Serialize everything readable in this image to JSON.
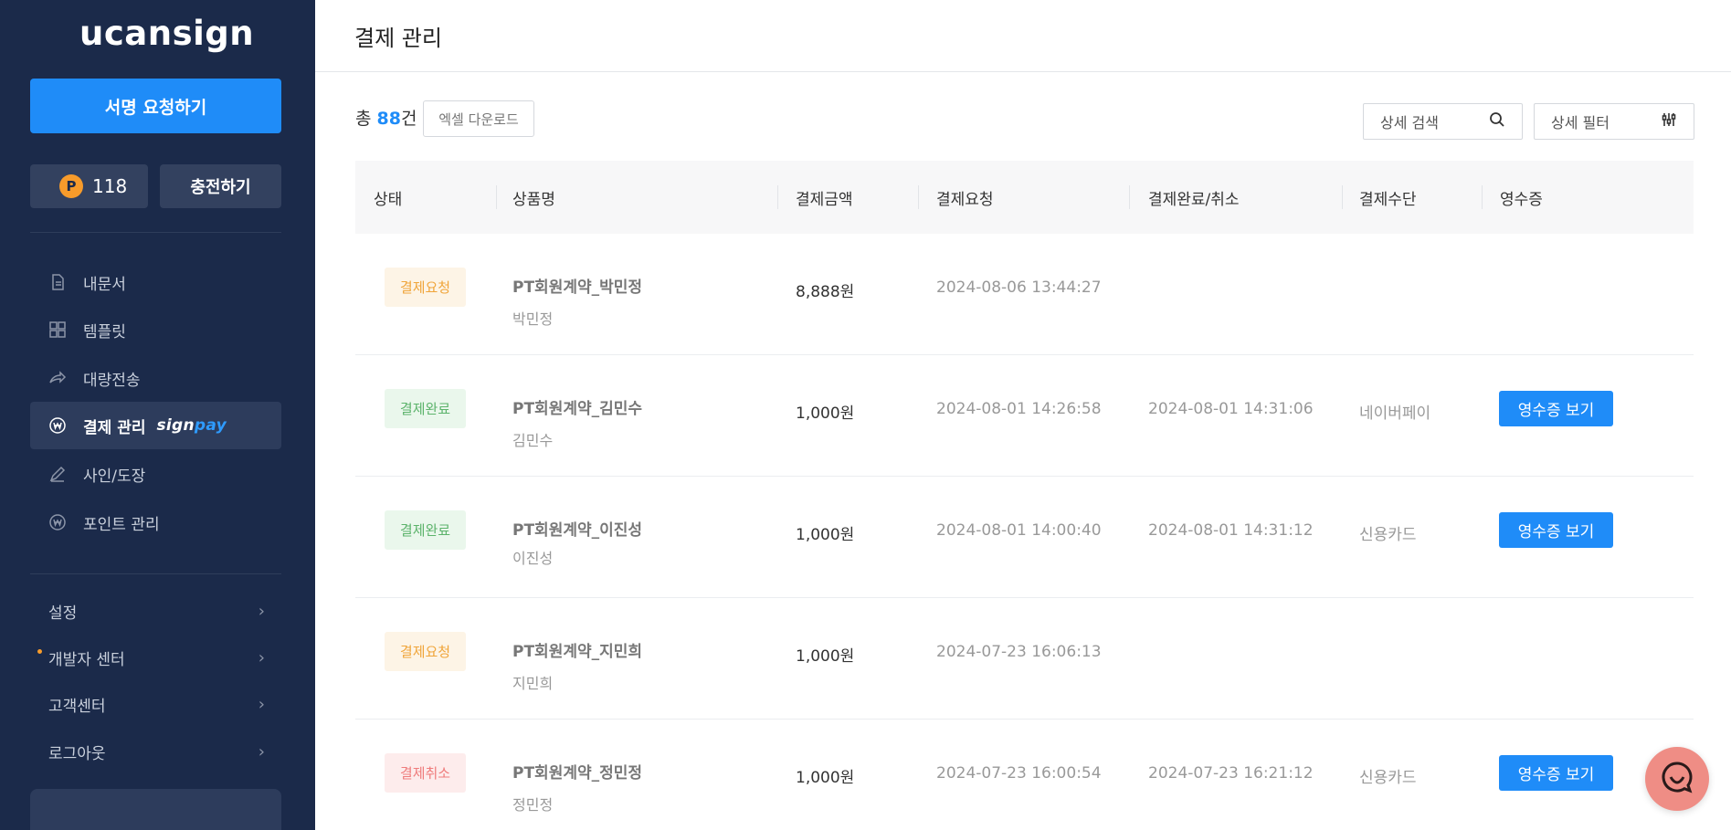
{
  "brand": {
    "logo_text": "ucansign"
  },
  "sidebar": {
    "request_button": "서명 요청하기",
    "points_value": "118",
    "points_icon": "P",
    "charge_button": "충전하기",
    "nav": [
      {
        "label": "내문서",
        "icon": "document-icon"
      },
      {
        "label": "템플릿",
        "icon": "template-icon"
      },
      {
        "label": "대량전송",
        "icon": "share-icon"
      },
      {
        "label": "결제 관리",
        "icon": "won-circle-icon",
        "badge_sign": "sign",
        "badge_pay": "pay"
      },
      {
        "label": "사인/도장",
        "icon": "pen-icon"
      },
      {
        "label": "포인트 관리",
        "icon": "won-circle-icon"
      }
    ],
    "sub": [
      {
        "label": "설정"
      },
      {
        "label": "개발자 센터"
      },
      {
        "label": "고객센터"
      },
      {
        "label": "로그아웃"
      }
    ]
  },
  "header": {
    "title": "결제 관리"
  },
  "toolbar": {
    "count_prefix": "총 ",
    "count": "88",
    "count_suffix": "건",
    "excel_button": "엑셀 다운로드",
    "search_label": "상세 검색",
    "filter_label": "상세 필터"
  },
  "table": {
    "columns": [
      "상태",
      "상품명",
      "결제금액",
      "결제요청",
      "결제완료/취소",
      "결제수단",
      "영수증"
    ],
    "rows": [
      {
        "status": "결제요청",
        "status_type": "req",
        "product": "PT회원계약_박민정",
        "customer": "박민정",
        "amount": "8,888원",
        "requested": "2024-08-06 13:44:27",
        "completed": "",
        "method": "",
        "receipt": ""
      },
      {
        "status": "결제완료",
        "status_type": "done",
        "product": "PT회원계약_김민수",
        "customer": "김민수",
        "amount": "1,000원",
        "requested": "2024-08-01 14:26:58",
        "completed": "2024-08-01 14:31:06",
        "method": "네이버페이",
        "receipt": "영수증 보기"
      },
      {
        "status": "결제완료",
        "status_type": "done",
        "product": "PT회원계약_이진성",
        "customer": "이진성",
        "amount": "1,000원",
        "requested": "2024-08-01 14:00:40",
        "completed": "2024-08-01 14:31:12",
        "method": "신용카드",
        "receipt": "영수증 보기"
      },
      {
        "status": "결제요청",
        "status_type": "req",
        "product": "PT회원계약_지민희",
        "customer": "지민희",
        "amount": "1,000원",
        "requested": "2024-07-23 16:06:13",
        "completed": "",
        "method": "",
        "receipt": ""
      },
      {
        "status": "결제취소",
        "status_type": "cancel",
        "product": "PT회원계약_정민정",
        "customer": "정민정",
        "amount": "1,000원",
        "requested": "2024-07-23 16:00:54",
        "completed": "2024-07-23 16:21:12",
        "method": "신용카드",
        "receipt": "영수증 보기"
      }
    ]
  },
  "colors": {
    "sidebar_bg": "#1b2a4a",
    "accent": "#1f8cf8",
    "coin": "#f79b2b",
    "chat": "#ef8d85"
  }
}
